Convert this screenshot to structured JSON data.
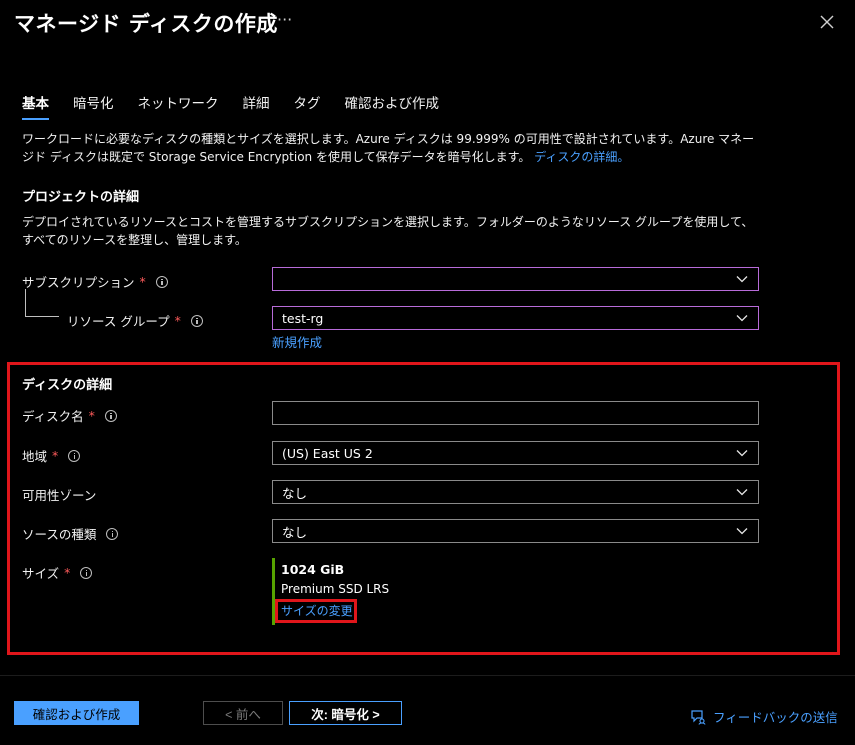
{
  "header": {
    "title": "マネージド ディスクの作成",
    "more": "···"
  },
  "tabs": [
    {
      "label": "基本"
    },
    {
      "label": "暗号化"
    },
    {
      "label": "ネットワーク"
    },
    {
      "label": "詳細"
    },
    {
      "label": "タグ"
    },
    {
      "label": "確認および作成"
    }
  ],
  "intro": {
    "text": "ワークロードに必要なディスクの種類とサイズを選択します。Azure ディスクは 99.999% の可用性で設計されています。Azure マネージド ディスクは既定で Storage Service Encryption を使用して保存データを暗号化します。",
    "link": "ディスクの詳細。"
  },
  "project": {
    "title": "プロジェクトの詳細",
    "description": "デプロイされているリソースとコストを管理するサブスクリプションを選択します。フォルダーのようなリソース グループを使用して、すべてのリソースを整理し、管理します。",
    "subscription_label": "サブスクリプション",
    "subscription_value": "",
    "resource_group_label": "リソース グループ",
    "resource_group_value": "test-rg",
    "create_new": "新規作成"
  },
  "disk": {
    "title": "ディスクの詳細",
    "name_label": "ディスク名",
    "name_value": "",
    "region_label": "地域",
    "region_value": "(US) East US 2",
    "zone_label": "可用性ゾーン",
    "zone_value": "なし",
    "source_label": "ソースの種類",
    "source_value": "なし",
    "size_label": "サイズ",
    "size_value": "1024 GiB",
    "size_sku": "Premium SSD LRS",
    "size_change": "サイズの変更"
  },
  "required_mark": "*",
  "footer": {
    "review_create": "確認および作成",
    "prev": "< 前へ",
    "next": "次: 暗号化 >",
    "feedback": "フィードバックの送信"
  },
  "colors": {
    "accent": "#4aa0ff",
    "required": "#ff5b5b",
    "highlight": "#e0161b",
    "size_bar": "#57a300"
  }
}
